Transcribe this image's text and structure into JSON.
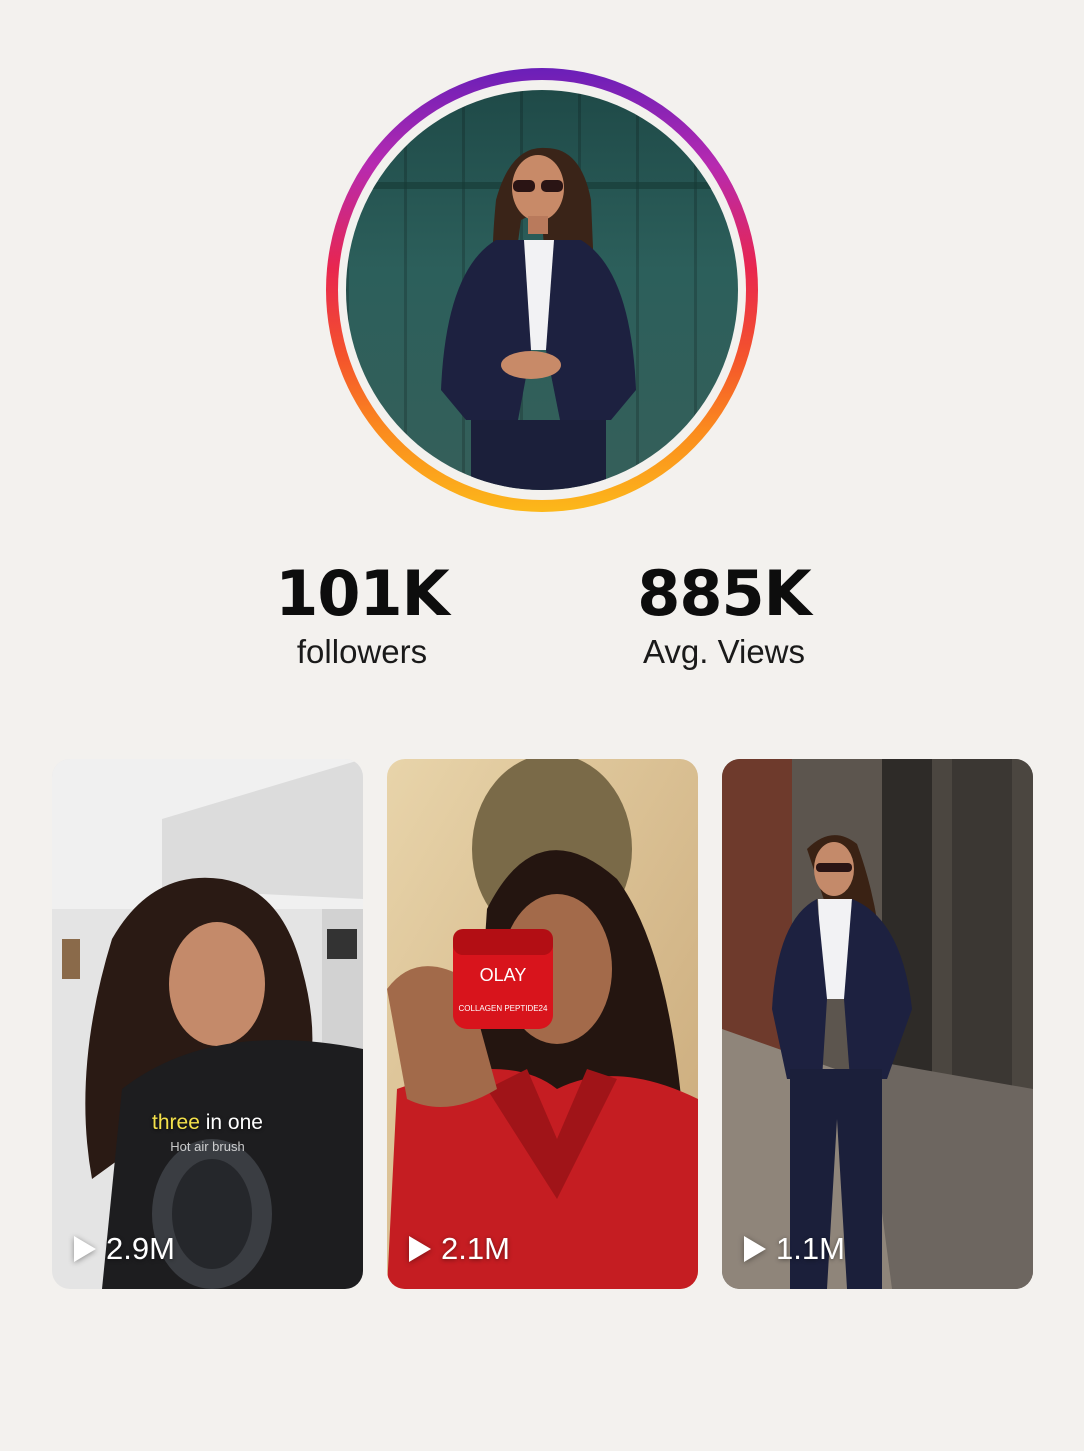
{
  "profile": {
    "ring_colors": [
      "#6a1fb8",
      "#e8264f",
      "#fb8c1e",
      "#fcb81a"
    ]
  },
  "stats": [
    {
      "value": "101K",
      "label": "followers"
    },
    {
      "value": "885K",
      "label": "Avg. Views"
    }
  ],
  "videos": [
    {
      "views": "2.9M",
      "caption_highlight": "three",
      "caption_rest": " in one",
      "subcaption": "Hot air brush"
    },
    {
      "views": "2.1M",
      "product_brand": "OLAY",
      "product_line": "COLLAGEN PEPTIDE24"
    },
    {
      "views": "1.1M"
    }
  ],
  "icons": {
    "play": "play-icon"
  }
}
